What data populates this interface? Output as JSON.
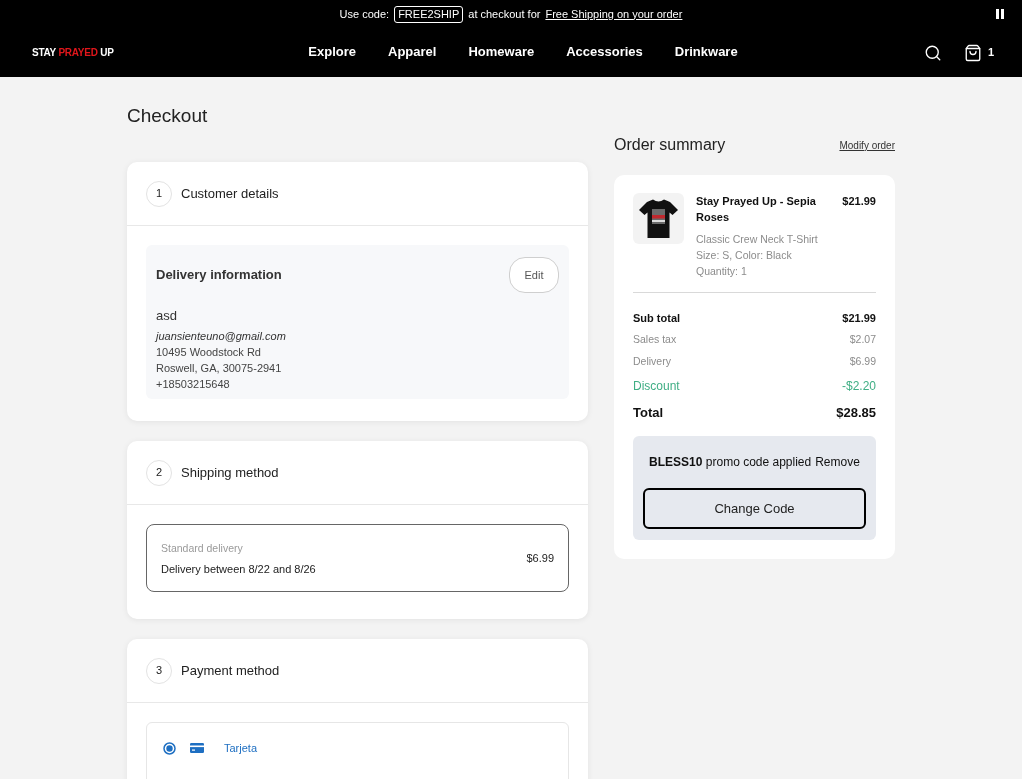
{
  "announcement": {
    "prefix": "Use code:",
    "code": "FREE2SHIP",
    "middle": "at checkout for",
    "link": "Free Shipping on your order"
  },
  "header": {
    "logo": {
      "before": "STAY",
      "highlight": "PRAYED",
      "after": "UP"
    },
    "nav": [
      {
        "label": "Explore"
      },
      {
        "label": "Apparel"
      },
      {
        "label": "Homeware"
      },
      {
        "label": "Accessories"
      },
      {
        "label": "Drinkware"
      }
    ],
    "cart_count": "1"
  },
  "page_title": "Checkout",
  "steps": [
    {
      "number": "1",
      "title": "Customer details",
      "kind": "delivery_info",
      "heading": "Delivery information",
      "edit": "Edit",
      "name": "asd",
      "email": "juansienteuno@gmail.com",
      "lines": [
        "10495 Woodstock Rd",
        "Roswell, GA, 30075-2941",
        "+18503215648"
      ]
    },
    {
      "number": "2",
      "title": "Shipping method",
      "kind": "shipping",
      "options": [
        {
          "name": "Standard delivery",
          "detail": "Delivery between 8/22 and 8/26",
          "price": "$6.99",
          "selected": true
        }
      ]
    },
    {
      "number": "3",
      "title": "Payment method",
      "kind": "payment",
      "options": [
        {
          "label": "Tarjeta",
          "selected": true
        }
      ]
    }
  ],
  "order_summary": {
    "title": "Order summary",
    "modify": "Modify order",
    "items": [
      {
        "name": "Stay Prayed Up - Sepia Roses",
        "price": "$21.99",
        "details": [
          "Classic Crew Neck T-Shirt",
          "Size: S, Color: Black",
          "Quantity: 1"
        ]
      }
    ],
    "totals": [
      {
        "label": "Sub total",
        "value": "$21.99",
        "kind": "subtotal"
      },
      {
        "label": "Sales tax",
        "value": "$2.07",
        "kind": "line"
      },
      {
        "label": "Delivery",
        "value": "$6.99",
        "kind": "line"
      },
      {
        "label": "Discount",
        "value": "-$2.20",
        "kind": "discount"
      },
      {
        "label": "Total",
        "value": "$28.85",
        "kind": "total"
      }
    ],
    "promo": {
      "code": "BLESS10",
      "message": "promo code applied",
      "action": "Remove",
      "button": "Change Code"
    }
  }
}
